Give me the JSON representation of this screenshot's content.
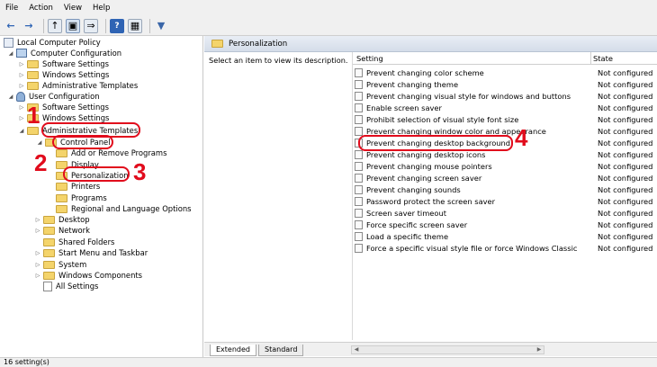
{
  "menu": [
    "File",
    "Action",
    "View",
    "Help"
  ],
  "tree": {
    "root": "Local Computer Policy",
    "computer_config": "Computer Configuration",
    "cc_software": "Software Settings",
    "cc_windows": "Windows Settings",
    "cc_admin": "Administrative Templates",
    "user_config": "User Configuration",
    "uc_software": "Software Settings",
    "uc_windows": "Windows Settings",
    "uc_admin": "Administrative Templates",
    "control_panel": "Control Panel",
    "add_remove": "Add or Remove Programs",
    "display": "Display",
    "personalization": "Personalization",
    "printers": "Printers",
    "programs": "Programs",
    "regional": "Regional and Language Options",
    "desktop": "Desktop",
    "network": "Network",
    "shared_folders": "Shared Folders",
    "start_menu": "Start Menu and Taskbar",
    "system": "System",
    "windows_components": "Windows Components",
    "all_settings": "All Settings"
  },
  "right": {
    "header": "Personalization",
    "description": "Select an item to view its description.",
    "col_setting": "Setting",
    "col_state": "State"
  },
  "settings": [
    {
      "name": "Prevent changing color scheme",
      "state": "Not configured"
    },
    {
      "name": "Prevent changing theme",
      "state": "Not configured"
    },
    {
      "name": "Prevent changing visual style for windows and buttons",
      "state": "Not configured"
    },
    {
      "name": "Enable screen saver",
      "state": "Not configured"
    },
    {
      "name": "Prohibit selection of visual style font size",
      "state": "Not configured"
    },
    {
      "name": "Prevent changing window color and appearance",
      "state": "Not configured"
    },
    {
      "name": "Prevent changing desktop background",
      "state": "Not configured"
    },
    {
      "name": "Prevent changing desktop icons",
      "state": "Not configured"
    },
    {
      "name": "Prevent changing mouse pointers",
      "state": "Not configured"
    },
    {
      "name": "Prevent changing screen saver",
      "state": "Not configured"
    },
    {
      "name": "Prevent changing sounds",
      "state": "Not configured"
    },
    {
      "name": "Password protect the screen saver",
      "state": "Not configured"
    },
    {
      "name": "Screen saver timeout",
      "state": "Not configured"
    },
    {
      "name": "Force specific screen saver",
      "state": "Not configured"
    },
    {
      "name": "Load a specific theme",
      "state": "Not configured"
    },
    {
      "name": "Force a specific visual style file or force Windows Classic",
      "state": "Not configured"
    }
  ],
  "tabs": {
    "extended": "Extended",
    "standard": "Standard"
  },
  "status": "16 setting(s)",
  "annotations": {
    "n1": "1",
    "n2": "2",
    "n3": "3",
    "n4": "4",
    "color": "#e10b1c"
  }
}
